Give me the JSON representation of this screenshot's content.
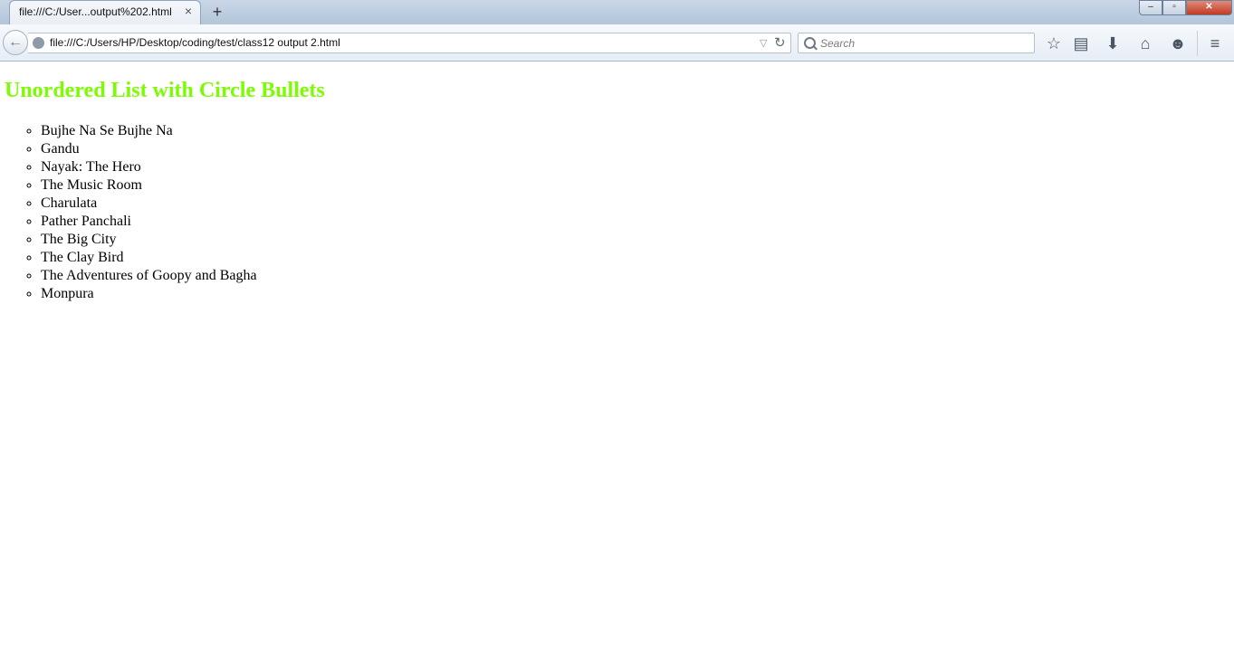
{
  "browser": {
    "tab": {
      "title": "file:///C:/User...output%202.html",
      "close": "×"
    },
    "new_tab": "+",
    "window_controls": {
      "minimize": "–",
      "maximize": "▫",
      "close": "✕"
    },
    "nav": {
      "back": "←",
      "url": "file:///C:/Users/HP/Desktop/coding/test/class12 output 2.html",
      "dropmarker": "▽",
      "reload": "↻"
    },
    "search": {
      "placeholder": "Search"
    },
    "toolbar_icons": {
      "bookmark": "☆",
      "reading_list": "▤",
      "downloads": "⬇",
      "home": "⌂",
      "chat": "☻",
      "menu": "≡"
    }
  },
  "page": {
    "heading": "Unordered List with Circle Bullets",
    "heading_color": "#7cfc00",
    "list_style": "circle",
    "items": [
      "Bujhe Na Se Bujhe Na",
      "Gandu",
      "Nayak: The Hero",
      "The Music Room",
      "Charulata",
      "Pather Panchali",
      "The Big City",
      "The Clay Bird",
      "The Adventures of Goopy and Bagha",
      "Monpura"
    ]
  }
}
